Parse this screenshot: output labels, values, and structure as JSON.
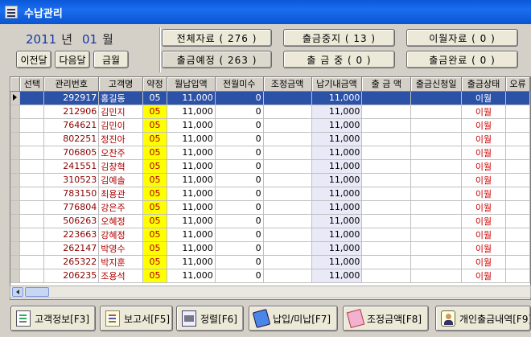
{
  "window": {
    "title": "수납관리"
  },
  "period": {
    "year": "2011",
    "year_label": "년",
    "month": "01",
    "month_label": "월"
  },
  "nav": {
    "prev": "이전달",
    "next": "다음달",
    "current": "금월"
  },
  "stats": {
    "all": "전체자료 ( 276 )",
    "scheduled": "출금예정 ( 263 )",
    "stopped": "출금중지 ( 13 )",
    "in_progress": "출 금 중 ( 0 )",
    "carryover": "이월자료 ( 0 )",
    "completed": "출금완료 ( 0 )"
  },
  "grid": {
    "columns": [
      "선택",
      "관리번호",
      "고객명",
      "약정",
      "월납입액",
      "전월미수",
      "조정금액",
      "납기내금액",
      "출 금 액",
      "출금신청일",
      "출금상태",
      "오류"
    ],
    "rows": [
      {
        "id": "292917",
        "name": "홍길동",
        "code": "05",
        "monthly": "11,000",
        "prev_unpaid": "0",
        "adjust": "",
        "due": "11,000",
        "withdraw": "",
        "req_date": "",
        "status": "이월"
      },
      {
        "id": "212906",
        "name": "김민지",
        "code": "05",
        "monthly": "11,000",
        "prev_unpaid": "0",
        "adjust": "",
        "due": "11,000",
        "withdraw": "",
        "req_date": "",
        "status": "이월"
      },
      {
        "id": "764621",
        "name": "김민이",
        "code": "05",
        "monthly": "11,000",
        "prev_unpaid": "0",
        "adjust": "",
        "due": "11,000",
        "withdraw": "",
        "req_date": "",
        "status": "이월"
      },
      {
        "id": "802251",
        "name": "정진아",
        "code": "05",
        "monthly": "11,000",
        "prev_unpaid": "0",
        "adjust": "",
        "due": "11,000",
        "withdraw": "",
        "req_date": "",
        "status": "이월"
      },
      {
        "id": "706805",
        "name": "오찬주",
        "code": "05",
        "monthly": "11,000",
        "prev_unpaid": "0",
        "adjust": "",
        "due": "11,000",
        "withdraw": "",
        "req_date": "",
        "status": "이월"
      },
      {
        "id": "241551",
        "name": "김창혁",
        "code": "05",
        "monthly": "11,000",
        "prev_unpaid": "0",
        "adjust": "",
        "due": "11,000",
        "withdraw": "",
        "req_date": "",
        "status": "이월"
      },
      {
        "id": "310523",
        "name": "김예솔",
        "code": "05",
        "monthly": "11,000",
        "prev_unpaid": "0",
        "adjust": "",
        "due": "11,000",
        "withdraw": "",
        "req_date": "",
        "status": "이월"
      },
      {
        "id": "783150",
        "name": "최용관",
        "code": "05",
        "monthly": "11,000",
        "prev_unpaid": "0",
        "adjust": "",
        "due": "11,000",
        "withdraw": "",
        "req_date": "",
        "status": "이월"
      },
      {
        "id": "776804",
        "name": "강은주",
        "code": "05",
        "monthly": "11,000",
        "prev_unpaid": "0",
        "adjust": "",
        "due": "11,000",
        "withdraw": "",
        "req_date": "",
        "status": "이월"
      },
      {
        "id": "506263",
        "name": "오혜정",
        "code": "05",
        "monthly": "11,000",
        "prev_unpaid": "0",
        "adjust": "",
        "due": "11,000",
        "withdraw": "",
        "req_date": "",
        "status": "이월"
      },
      {
        "id": "223663",
        "name": "강혜정",
        "code": "05",
        "monthly": "11,000",
        "prev_unpaid": "0",
        "adjust": "",
        "due": "11,000",
        "withdraw": "",
        "req_date": "",
        "status": "이월"
      },
      {
        "id": "262147",
        "name": "박영수",
        "code": "05",
        "monthly": "11,000",
        "prev_unpaid": "0",
        "adjust": "",
        "due": "11,000",
        "withdraw": "",
        "req_date": "",
        "status": "이월"
      },
      {
        "id": "265322",
        "name": "박지훈",
        "code": "05",
        "monthly": "11,000",
        "prev_unpaid": "0",
        "adjust": "",
        "due": "11,000",
        "withdraw": "",
        "req_date": "",
        "status": "이월"
      },
      {
        "id": "206235",
        "name": "조용석",
        "code": "05",
        "monthly": "11,000",
        "prev_unpaid": "0",
        "adjust": "",
        "due": "11,000",
        "withdraw": "",
        "req_date": "",
        "status": "이월"
      }
    ]
  },
  "toolbar": {
    "customer_info": "고객정보[F3]",
    "report": "보고서[F5]",
    "sort": "정렬[F6]",
    "payment": "납입/미납[F7]",
    "adjustment": "조정금액[F8]",
    "personal_history": "개인출금내역[F9]"
  },
  "icons": {
    "customer_info": "customer-doc-icon",
    "report": "report-icon",
    "sort": "sort-icon",
    "payment": "payment-card-icon",
    "adjustment": "adjust-card-icon",
    "personal_history": "person-icon"
  },
  "colors": {
    "title_bar": "#0a58d8",
    "selected_row": "#2c52a8",
    "contract_highlight": "#ffff00",
    "due_column": "#e9e9f8",
    "status_text": "#cc0000"
  }
}
